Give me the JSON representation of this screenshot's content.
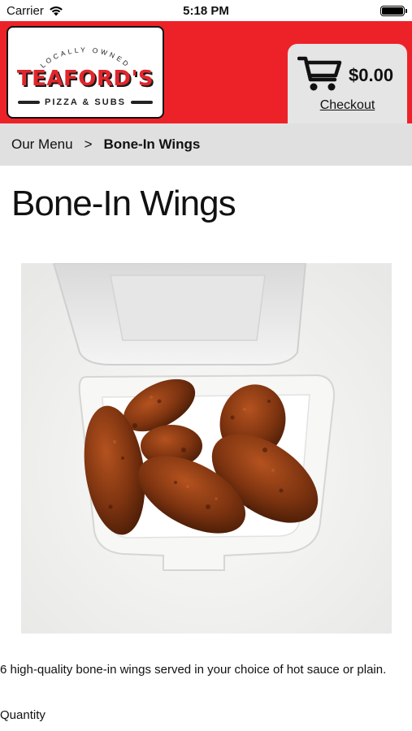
{
  "status_bar": {
    "carrier": "Carrier",
    "time": "5:18 PM",
    "icons": [
      "wifi-icon",
      "battery-icon"
    ]
  },
  "header": {
    "brand_color": "#ed2229",
    "logo": {
      "arc_text": "LOCALLY OWNED",
      "name": "TEAFORD'S",
      "subtitle": "PIZZA & SUBS"
    },
    "cart": {
      "icon": "cart-icon",
      "total": "$0.00",
      "checkout_label": "Checkout"
    }
  },
  "breadcrumb": {
    "parent": "Our Menu",
    "separator": ">",
    "current": "Bone-In Wings"
  },
  "product": {
    "title": "Bone-In Wings",
    "image_alt": "Bone-in wings in a foam container",
    "description": "6 high-quality bone-in wings served in your choice of hot sauce or plain.",
    "quantity_label": "Quantity"
  }
}
